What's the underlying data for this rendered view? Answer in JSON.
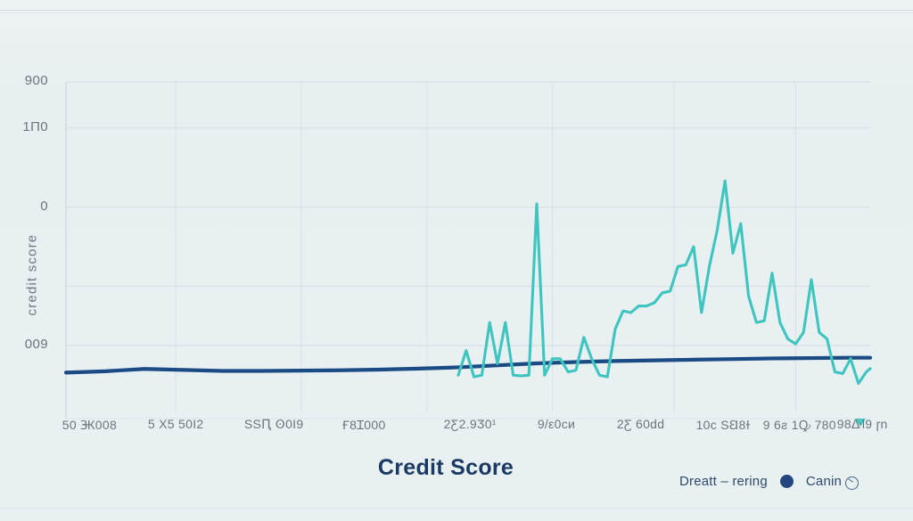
{
  "chart_data": {
    "type": "line",
    "title": "Credit Score",
    "xlabel": "",
    "ylabel": "credit score",
    "grid": true,
    "legend_position": "bottom-right",
    "xlim": [
      0,
      41
    ],
    "ylim": [
      0,
      100
    ],
    "y_ticks": [
      {
        "label": "900",
        "value": 100
      },
      {
        "label": "1П0",
        "value": 86
      },
      {
        "label": "0",
        "value": 62
      },
      {
        "label": "009",
        "value": 20
      }
    ],
    "x_ticks": [
      {
        "label": "50 Ꚅ008",
        "value": 1.2
      },
      {
        "label": "5 Х5 50I2",
        "value": 5.6
      },
      {
        "label": "SSԤ Ꙩ0I9",
        "value": 10.6
      },
      {
        "label": "Ғ8Ɪ000",
        "value": 15.2
      },
      {
        "label": "2Ƹ2.9Ӡ0¹",
        "value": 20.6
      },
      {
        "label": "9/ε0ᴄᴎ",
        "value": 25.0
      },
      {
        "label": "2Ƹ 60dԁ",
        "value": 29.3
      },
      {
        "label": "10ᴄ SꞚ8ɫ",
        "value": 33.5
      },
      {
        "label": "9 6ƨ 1Ꝙ 780",
        "value": 37.4
      },
      {
        "label": "98ᐏƖ9 ɼn",
        "value": 40.6
      }
    ],
    "series": [
      {
        "name": "Dreatt – rering",
        "color": "#1b4b84",
        "style": "solid",
        "x": [
          0,
          2,
          4,
          6,
          8,
          10,
          12,
          14,
          16,
          18,
          20,
          22,
          24,
          26,
          28,
          30,
          32,
          34,
          36,
          38,
          40,
          41
        ],
        "values": [
          11.8,
          12.2,
          12.9,
          12.6,
          12.3,
          12.3,
          12.4,
          12.5,
          12.7,
          13.0,
          13.4,
          14.0,
          14.6,
          15.0,
          15.3,
          15.5,
          15.7,
          15.9,
          16.1,
          16.2,
          16.3,
          16.3
        ]
      },
      {
        "name": "Canin",
        "color": "#3fc5bf",
        "style": "solid",
        "x": [
          20.0,
          20.4,
          20.8,
          21.2,
          21.6,
          22.0,
          22.4,
          22.8,
          23.2,
          23.6,
          24.0,
          24.4,
          24.8,
          25.2,
          25.6,
          26.0,
          26.4,
          26.8,
          27.2,
          27.6,
          28.0,
          28.4,
          28.8,
          29.2,
          29.6,
          30.0,
          30.4,
          30.8,
          31.2,
          31.6,
          32.0,
          32.4,
          32.8,
          33.2,
          33.6,
          34.0,
          34.4,
          34.8,
          35.2,
          35.6,
          36.0,
          36.4,
          36.8,
          37.2,
          37.6,
          38.0,
          38.4,
          38.8,
          39.2,
          39.6,
          40.0,
          40.4,
          40.8,
          41.0
        ],
        "values": [
          11.0,
          18.5,
          10.5,
          11.0,
          27.0,
          14.5,
          27.0,
          11.0,
          10.8,
          11.0,
          63.0,
          11.0,
          16.0,
          16.0,
          12.0,
          12.5,
          22.5,
          16.0,
          11.0,
          10.5,
          25.0,
          30.5,
          30.0,
          32.0,
          32.0,
          33.0,
          36.0,
          36.5,
          44.0,
          44.5,
          50.0,
          30.0,
          44.0,
          55.0,
          70.0,
          48.0,
          57.0,
          35.0,
          27.0,
          27.5,
          42.0,
          27.0,
          22.0,
          20.5,
          24.0,
          40.0,
          24.0,
          22.0,
          12.0,
          11.5,
          16.0,
          8.5,
          12.0,
          13.0
        ]
      }
    ],
    "marker": {
      "name": "teal-triangle-marker",
      "x": 40.5,
      "color": "#3fc5bf"
    }
  },
  "legend": {
    "entries": [
      {
        "label": "Dreatt – rering",
        "swatch": "none"
      },
      {
        "label": "Canin",
        "swatch": "dot",
        "color": "#23467e"
      }
    ]
  },
  "colors": {
    "background": "#e9f0f2",
    "navy_series": "#1b4b84",
    "teal_series": "#3fc5bf",
    "title": "#1b3a63",
    "tick_text": "#5d6c74",
    "gridline": "#cfd9dd"
  }
}
